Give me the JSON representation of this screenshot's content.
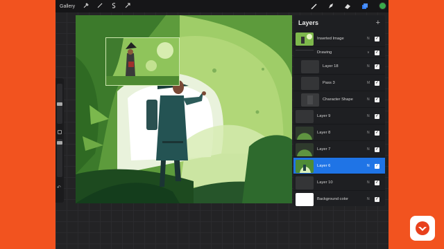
{
  "topbar": {
    "gallery_label": "Gallery",
    "left_tools": [
      "wrench-icon",
      "magic-wand-icon",
      "selection-icon",
      "transform-arrow-icon"
    ],
    "right_tools": [
      "brush-icon",
      "smudge-icon",
      "eraser-icon",
      "layers-icon"
    ],
    "active_color": "#3aa84a",
    "layers_accent": "#2f7bf2"
  },
  "layers_panel": {
    "title": "Layers",
    "add_label": "+",
    "selected_accent": "#1f74e6",
    "layers": [
      {
        "name": "Inserted Image",
        "mode": "N",
        "visible": true,
        "indent": false,
        "type": "image"
      },
      {
        "name": "Drawing",
        "mode": "∨",
        "visible": true,
        "indent": false,
        "type": "group"
      },
      {
        "name": "Layer 18",
        "mode": "N",
        "visible": true,
        "indent": true,
        "type": "dark"
      },
      {
        "name": "Pass 3",
        "mode": "M",
        "visible": true,
        "indent": true,
        "type": "dark"
      },
      {
        "name": "Character Shape",
        "mode": "N",
        "visible": true,
        "indent": true,
        "type": "checker"
      },
      {
        "name": "Layer 9",
        "mode": "N",
        "visible": true,
        "indent": false,
        "type": "dark"
      },
      {
        "name": "Layer 8",
        "mode": "N",
        "visible": true,
        "indent": false,
        "type": "arch"
      },
      {
        "name": "Layer 7",
        "mode": "N",
        "visible": true,
        "indent": false,
        "type": "arch"
      },
      {
        "name": "Layer 6",
        "mode": "N",
        "visible": true,
        "indent": false,
        "type": "scene",
        "selected": true
      },
      {
        "name": "Layer 10",
        "mode": "N",
        "visible": true,
        "indent": false,
        "type": "dark"
      },
      {
        "name": "Background color",
        "mode": "N",
        "visible": true,
        "indent": false,
        "type": "white"
      }
    ]
  },
  "canvas": {
    "background": "#4e8c36"
  },
  "sidebar": {
    "undo_icon": "undo-icon",
    "modify_icon": "square-icon"
  },
  "brand": {
    "logo": "domestika-logo-icon",
    "brand_color": "#e8401c"
  },
  "check_glyph": "✓"
}
